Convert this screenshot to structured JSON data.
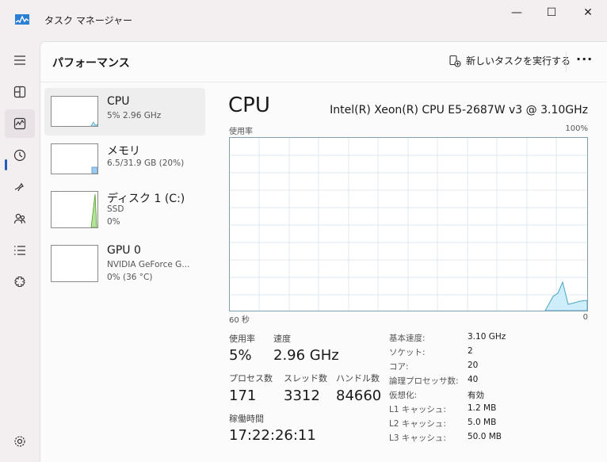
{
  "app": {
    "title": "タスク マネージャー"
  },
  "window_buttons": {
    "minimize": "—",
    "maximize": "☐",
    "close": "✕"
  },
  "header": {
    "title": "パフォーマンス",
    "new_task": "新しいタスクを実行する",
    "more": "···"
  },
  "nav_icons": [
    "menu-icon",
    "processes-icon",
    "performance-icon",
    "history-icon",
    "startup-icon",
    "users-icon",
    "details-icon",
    "services-icon",
    "settings-icon"
  ],
  "devices": [
    {
      "name": "CPU",
      "sub1": "5%  2.96 GHz",
      "sub2": "",
      "sub3": ""
    },
    {
      "name": "メモリ",
      "sub1": "6.5/31.9 GB (20%)",
      "sub2": "",
      "sub3": ""
    },
    {
      "name": "ディスク 1 (C:)",
      "sub1": "SSD",
      "sub2": "0%",
      "sub3": ""
    },
    {
      "name": "GPU 0",
      "sub1": "NVIDIA GeForce G...",
      "sub2": "0%  (36 °C)",
      "sub3": ""
    }
  ],
  "detail": {
    "title": "CPU",
    "model": "Intel(R) Xeon(R) CPU E5-2687W v3 @ 3.10GHz",
    "graph_label_left": "使用率",
    "graph_label_right": "100%",
    "graph_bottom_left": "60 秒",
    "graph_bottom_right": "0"
  },
  "stats": {
    "usage_label": "使用率",
    "usage_value": "5%",
    "speed_label": "速度",
    "speed_value": "2.96 GHz",
    "processes_label": "プロセス数",
    "processes_value": "171",
    "threads_label": "スレッド数",
    "threads_value": "3312",
    "handles_label": "ハンドル数",
    "handles_value": "84660",
    "uptime_label": "稼働時間",
    "uptime_value": "17:22:26:11"
  },
  "specs": [
    {
      "key": "基本速度:",
      "value": "3.10 GHz"
    },
    {
      "key": "ソケット:",
      "value": "2"
    },
    {
      "key": "コア:",
      "value": "20"
    },
    {
      "key": "論理プロセッサ数:",
      "value": "40"
    },
    {
      "key": "仮想化:",
      "value": "有効"
    },
    {
      "key": "L1 キャッシュ:",
      "value": "1.2 MB"
    },
    {
      "key": "L2 キャッシュ:",
      "value": "5.0 MB"
    },
    {
      "key": "L3 キャッシュ:",
      "value": "50.0 MB"
    }
  ],
  "colors": {
    "accent": "#1f5fbf",
    "cpu_graph": "#4aa3c8",
    "cpu_fill": "#cdeefa",
    "memory_fill": "#9ecbf0",
    "disk_graph": "#4e9a2a",
    "grid": "#dde9ef"
  }
}
